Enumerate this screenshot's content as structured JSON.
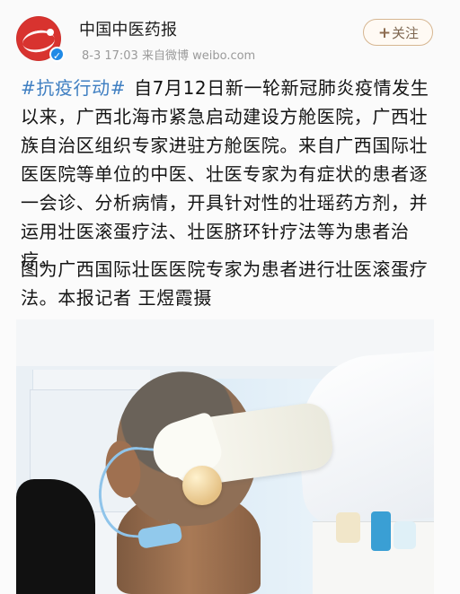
{
  "header": {
    "account_name": "中国中医药报",
    "meta": "8-3 17:03  来自微博 weibo.com",
    "follow_label": "关注"
  },
  "post": {
    "hashtag": "#抗疫行动#",
    "body": " 自7月12日新一轮新冠肺炎疫情发生以来，广西北海市紧急启动建设方舱医院，广西壮族自治区组织专家进驻方舱医院。来自广西国际壮医医院等单位的中医、壮医专家为有症状的患者逐一会诊、分析病情，开具针对性的壮瑶药方剂，并运用壮医滚蛋疗法、壮医脐环针疗法等为患者治疗。",
    "caption": "图为广西国际壮医医院专家为患者进行壮医滚蛋疗法。本报记者 王煜霞摄"
  },
  "icons": {
    "avatar": "publisher-logo-icon",
    "verified": "verified-icon",
    "follow": "plus-icon"
  },
  "colors": {
    "hashtag": "#3f7fc2",
    "verified": "#1f8ae6",
    "avatar": "#d8332f"
  }
}
